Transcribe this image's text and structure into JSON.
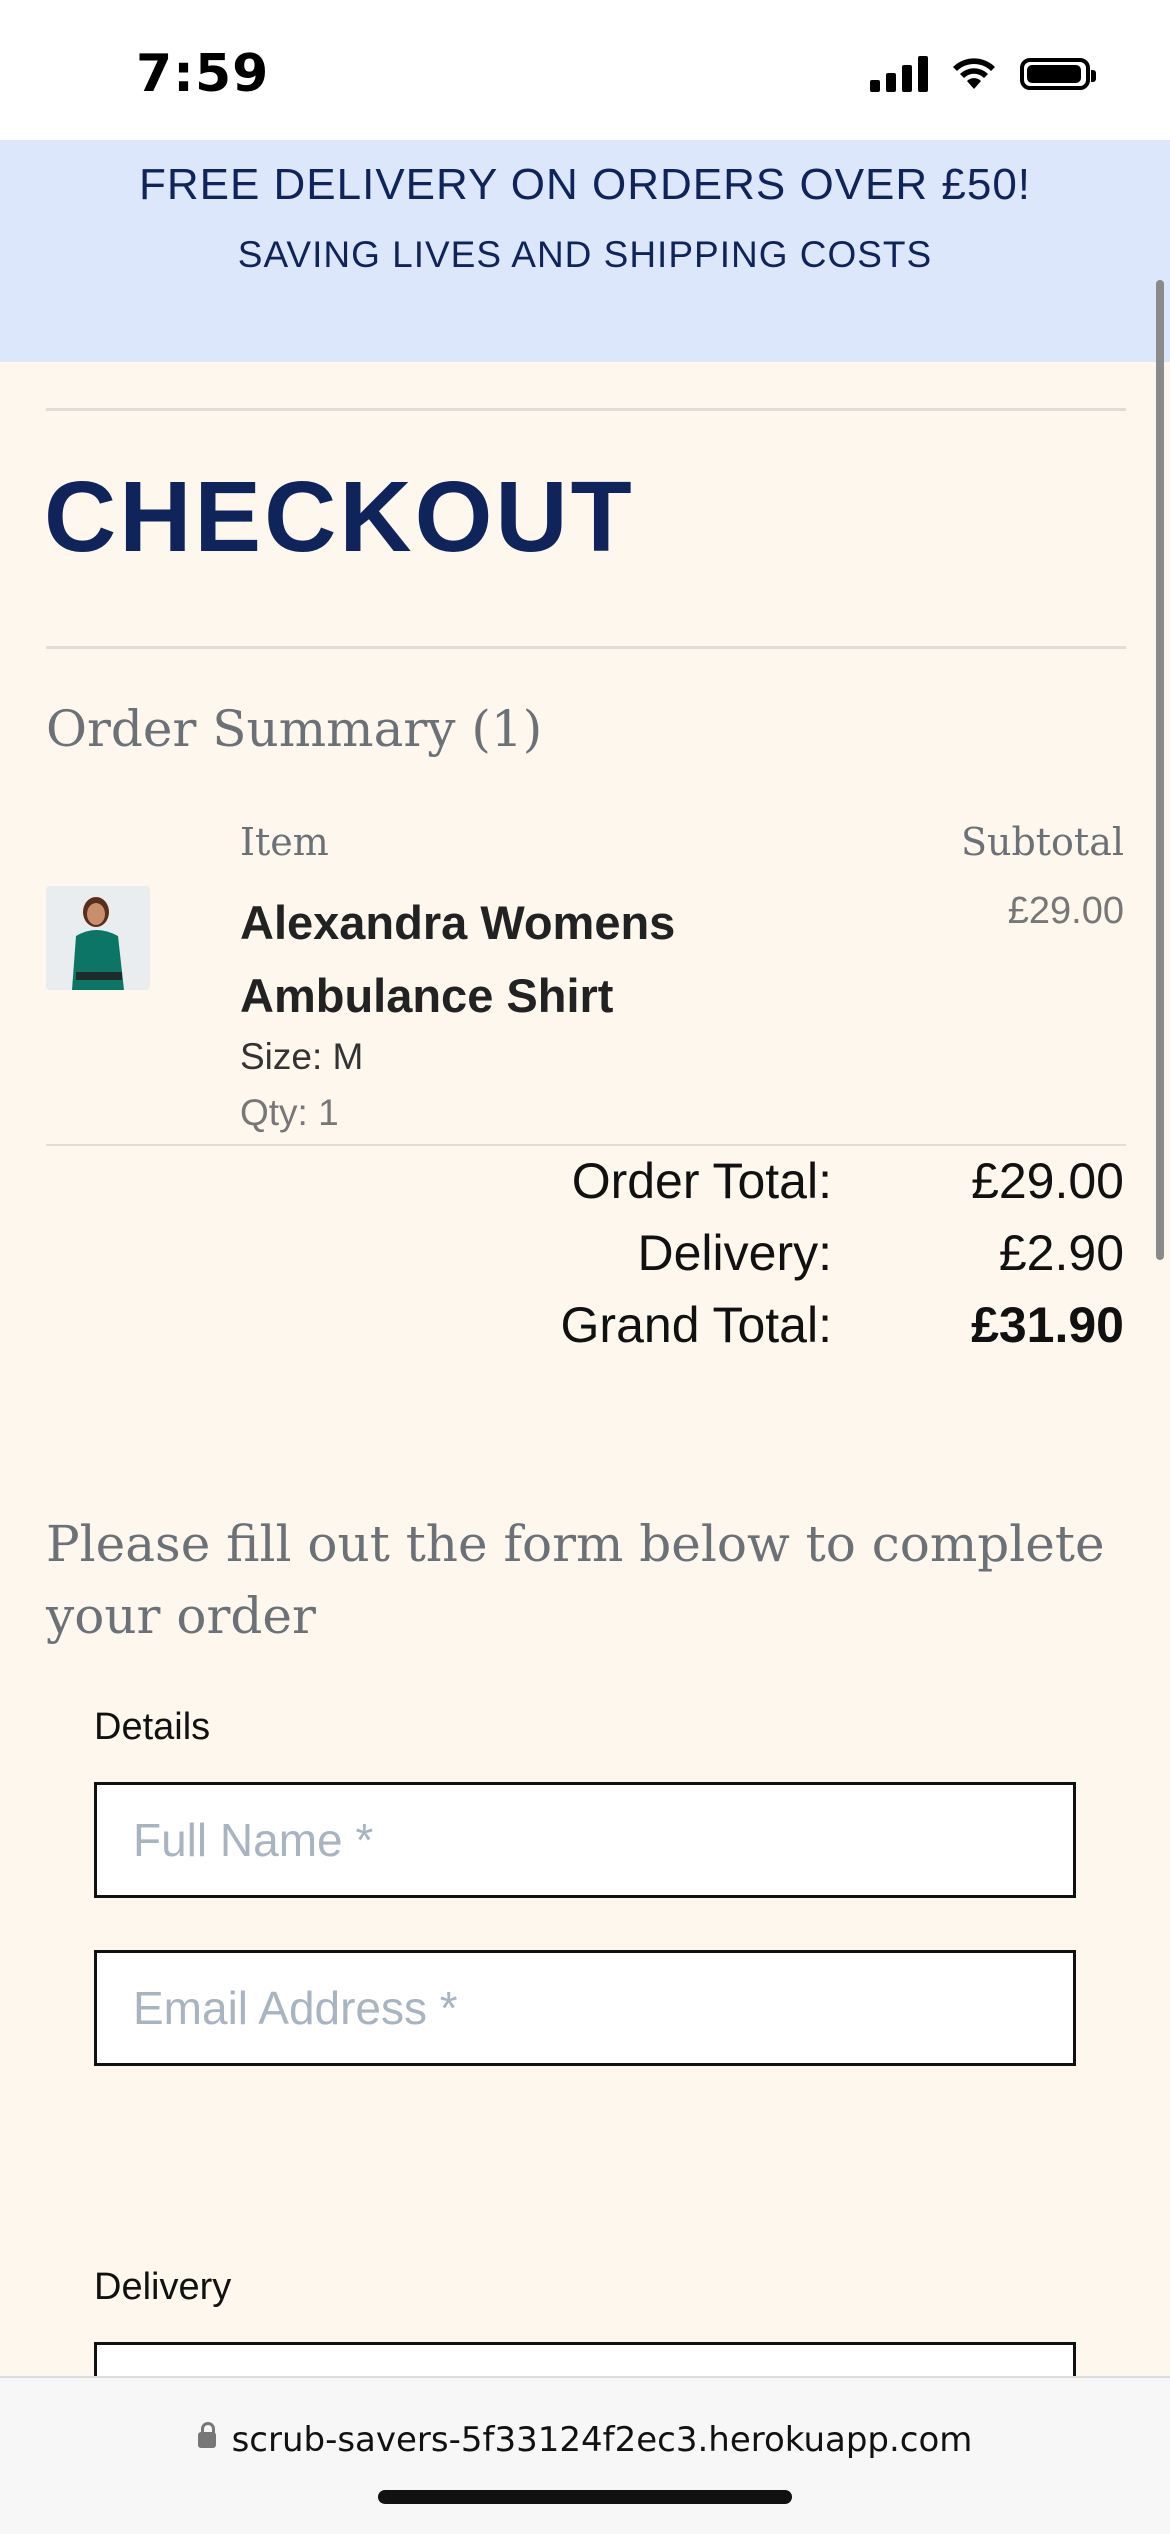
{
  "status_bar": {
    "time": "7:59"
  },
  "promo": {
    "title": "FREE DELIVERY ON ORDERS OVER £50!",
    "subtitle": "SAVING LIVES AND SHIPPING COSTS"
  },
  "page": {
    "title": "CHECKOUT"
  },
  "order_summary": {
    "heading": "Order Summary (1)",
    "columns": {
      "item": "Item",
      "subtotal": "Subtotal"
    },
    "items": [
      {
        "name": "Alexandra Womens Ambulance Shirt",
        "size": "Size: M",
        "qty": "Qty: 1",
        "subtotal": "£29.00"
      }
    ],
    "totals": {
      "order_total_label": "Order Total:",
      "order_total": "£29.00",
      "delivery_label": "Delivery:",
      "delivery": "£2.90",
      "grand_total_label": "Grand Total:",
      "grand_total": "£31.90"
    }
  },
  "form": {
    "intro": "Please fill out the form below to complete your order",
    "details_label": "Details",
    "full_name_placeholder": "Full Name *",
    "email_placeholder": "Email Address *",
    "delivery_label": "Delivery"
  },
  "browser": {
    "url": "scrub-savers-5f33124f2ec3.herokuapp.com"
  },
  "colors": {
    "navy": "#10245c",
    "banner": "#dde7fb",
    "background": "#fdf7ee"
  }
}
